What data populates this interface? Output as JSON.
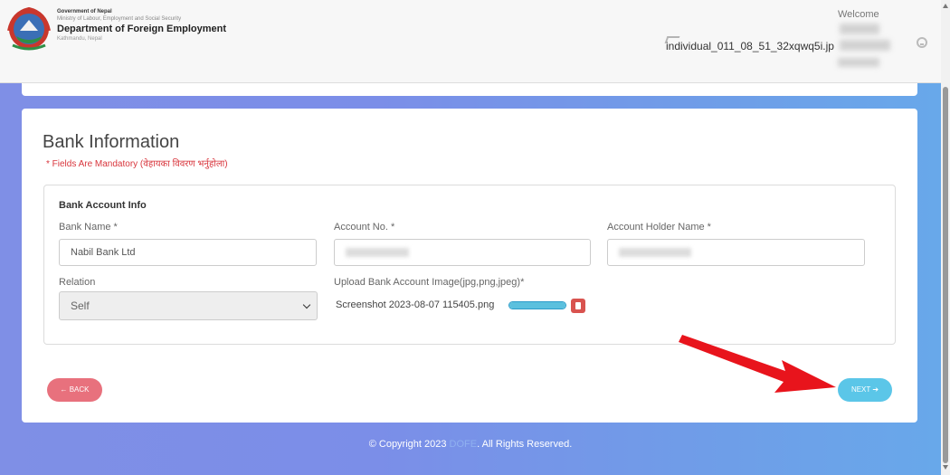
{
  "header": {
    "gov_title": "Government of Nepal",
    "ministry": "Ministry of Labour, Employment and Social Security",
    "department": "Department of Foreign Employment",
    "city": "Kathmandu, Nepal",
    "profile_image_alt": "individual_011_08_51_32xqwq5i.jp",
    "welcome": "Welcome"
  },
  "form": {
    "title": "Bank Information",
    "mandatory_note": "* Fields Are Mandatory (वेहायका विवरण भर्नुहोला)",
    "section_title": "Bank Account Info",
    "bank_name_label": "Bank Name *",
    "bank_name_value": "Nabil Bank Ltd",
    "account_no_label": "Account No. *",
    "account_holder_label": "Account Holder Name *",
    "relation_label": "Relation",
    "relation_value": "Self",
    "upload_label": "Upload Bank Account Image(jpg,png,jpeg)*",
    "file_name": "Screenshot 2023-08-07 115405.png",
    "upload_progress": 1.0
  },
  "buttons": {
    "back": "← BACK",
    "next": "NEXT ➔"
  },
  "footer": {
    "prefix": "© Copyright 2023",
    "brand": "DOFE",
    "suffix": ". All Rights Reserved."
  },
  "colors": {
    "back_button": "#e8717d",
    "next_button": "#5bc6e8",
    "mandatory_text": "#d8353c",
    "annotation_arrow": "#e8141c"
  }
}
